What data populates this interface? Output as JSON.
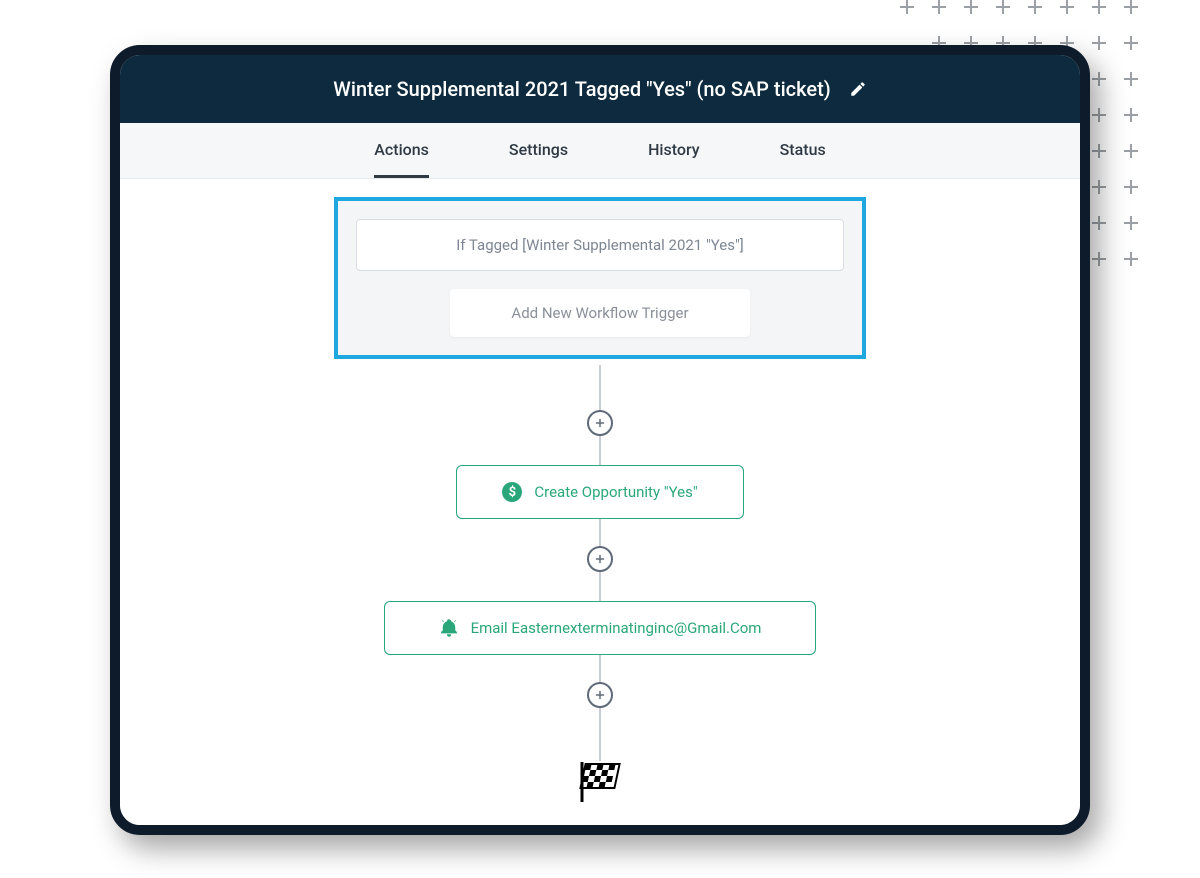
{
  "header": {
    "title": "Winter Supplemental 2021 Tagged \"Yes\" (no SAP ticket)"
  },
  "tabs": [
    {
      "label": "Actions",
      "active": true
    },
    {
      "label": "Settings",
      "active": false
    },
    {
      "label": "History",
      "active": false
    },
    {
      "label": "Status",
      "active": false
    }
  ],
  "trigger": {
    "condition_label": "If Tagged [Winter Supplemental 2021 \"Yes\"]",
    "add_label": "Add New Workflow Trigger"
  },
  "nodes": {
    "opportunity": {
      "label": "Create Opportunity \"Yes\""
    },
    "email": {
      "label": "Email Easternexterminatinginc@Gmail.Com"
    }
  },
  "colors": {
    "header_bg": "#0d2a3e",
    "accent_blue": "#1fa7e0",
    "action_green": "#2aa77a"
  }
}
